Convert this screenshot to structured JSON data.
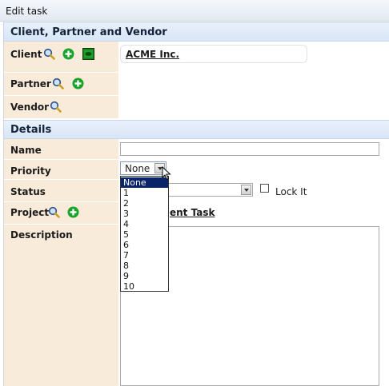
{
  "window": {
    "title": "Edit task"
  },
  "sections": {
    "cpv": "Client, Partner and Vendor",
    "details": "Details"
  },
  "labels": {
    "client": "Client",
    "partner": "Partner",
    "vendor": "Vendor",
    "name": "Name",
    "priority": "Priority",
    "status": "Status",
    "project": "Project",
    "description": "Description"
  },
  "client_value": "ACME Inc.",
  "name_value": "",
  "priority": {
    "selected": "None",
    "options": [
      "None",
      "1",
      "2",
      "3",
      "4",
      "5",
      "6",
      "7",
      "8",
      "9",
      "10"
    ],
    "highlighted_index": 0
  },
  "status_value": "",
  "lock_it": {
    "label": "Lock It",
    "checked": false
  },
  "parent_task_link": "ent Task",
  "description_value": "",
  "icons": {
    "search": "magnifier-icon",
    "add": "plus-circle-icon",
    "view": "eye-icon"
  },
  "colors": {
    "label_bg": "#f9ebd9",
    "section_bg": "#d7e5f6",
    "add_green": "#1aa32a",
    "selection": "#0a246a"
  }
}
